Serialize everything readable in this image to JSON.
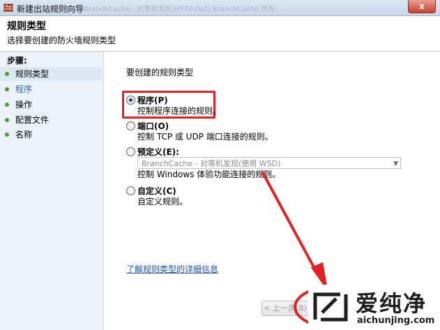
{
  "window": {
    "title": "新建出站规则向导",
    "close_glyph": "x",
    "bg_text": "BranchCache - 对等机发现(HTTP-Out)    BranchCache    所有  ..."
  },
  "header": {
    "title": "规则类型",
    "subtitle": "选择要创建的防火墙规则类型"
  },
  "sidebar": {
    "title": "步骤:",
    "items": [
      {
        "label": "规则类型"
      },
      {
        "label": "程序"
      },
      {
        "label": "操作"
      },
      {
        "label": "配置文件"
      },
      {
        "label": "名称"
      }
    ]
  },
  "main": {
    "question": "要创建的规则类型",
    "options": [
      {
        "name": "程序(P)",
        "desc": "控制程序连接的规则。",
        "checked": true
      },
      {
        "name": "端口(O)",
        "desc": "控制 TCP 或 UDP 端口连接的规则。",
        "checked": false
      },
      {
        "name": "预定义(E):",
        "desc": "控制 Windows 体验功能连接的规则。",
        "checked": false
      },
      {
        "name": "自定义(C)",
        "desc": "自定义规则。",
        "checked": false
      }
    ],
    "predefined_select": "BranchCache - 对等机发现(使用 WSD)",
    "link": "了解规则类型的详细信息",
    "back_button": "< 上一步(B)"
  },
  "watermark": {
    "name": "爱纯净",
    "url": "aichunjing.com"
  },
  "colors": {
    "accent": "#1a55b4",
    "highlight": "#e02323",
    "sidebar_bg": "#ecf2f9"
  }
}
